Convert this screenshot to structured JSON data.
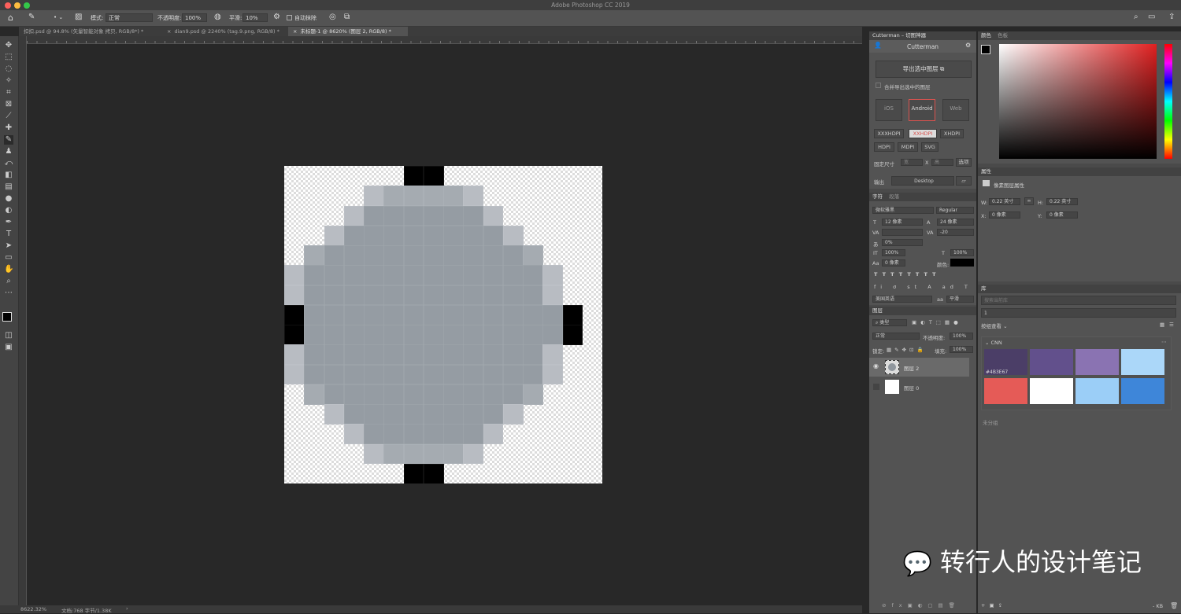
{
  "app": {
    "title": "Adobe Photoshop CC 2019"
  },
  "options_bar": {
    "mode_label": "模式:",
    "mode_value": "正常",
    "opacity_label": "不透明度:",
    "opacity_value": "100%",
    "smooth_label": "平滑:",
    "smooth_value": "10%",
    "auto_erase_label": "自动抹除"
  },
  "doc_tabs": [
    {
      "label": "扣扣.psd @ 94.8% (矢量智能对象 拷贝, RGB/8*) *"
    },
    {
      "label": "dian9.psd @ 2240% (tag.9.png, RGB/8) *"
    },
    {
      "label": "未标题-1 @ 8620% (图层 2, RGB/8) *"
    }
  ],
  "status": {
    "zoom": "8622.32%",
    "doc": "文档:768 字节/1.38K"
  },
  "cutterman": {
    "tab": "Cutterman – 切图神器",
    "title": "Cutterman",
    "export_button": "导出选中图层",
    "merge_label": "合并导出选中的图层",
    "platforms": [
      "iOS",
      "Android",
      "Web"
    ],
    "dpi_row1": [
      "XXXHDPI",
      "XXHDPI",
      "XHDPI"
    ],
    "dpi_row2": [
      "HDPI",
      "MDPI",
      "SVG"
    ],
    "size_label": "固定尺寸",
    "width_ph": "宽",
    "x_label": "X",
    "height_ph": "高",
    "select_button": "选项",
    "output_label": "输出",
    "output_value": "Desktop"
  },
  "color_panel": {
    "tabs": [
      "颜色",
      "色板"
    ]
  },
  "properties_panel": {
    "tab": "属性",
    "type_label": "像素图层属性",
    "w_label": "W:",
    "w_value": "0.22 英寸",
    "h_label": "H:",
    "h_value": "0.22 英寸",
    "x_label": "X:",
    "x_value": "0 像素",
    "y_label": "Y:",
    "y_value": "0 像素"
  },
  "character_panel": {
    "tabs": [
      "字符",
      "段落"
    ],
    "font": "微软雅黑",
    "style": "Regular",
    "size": "12 像素",
    "leading": "24 像素",
    "tracking": "-20",
    "scale_pct": "0%",
    "vscale": "100%",
    "hscale": "100%",
    "baseline": "0 像素",
    "color_label": "颜色:",
    "language": "美国英语",
    "aa_label": "aa",
    "aa_value": "平滑"
  },
  "layers_panel": {
    "tab": "图层",
    "filter": "类型",
    "blend": "正常",
    "opacity_label": "不透明度:",
    "opacity_value": "100%",
    "lock_label": "锁定:",
    "fill_label": "填充:",
    "fill_value": "100%",
    "layers": [
      {
        "name": "图层 2"
      },
      {
        "name": "图层 0"
      }
    ]
  },
  "library_panel": {
    "tab": "库",
    "search_ph": "搜索当前库",
    "library_value": "1",
    "view_label": "按组查看",
    "group": "CNN",
    "hex": "#4B3E67",
    "ungrouped": "未分组",
    "size_label": "KB",
    "swatch_colors": [
      "#4B3E67",
      "#62508C",
      "#8A73B2",
      "#ABD7F9",
      "#E55B57",
      "#FFFFFF",
      "#9BCEF7",
      "#3E86D9"
    ]
  },
  "watermark": "转行人的设计笔记",
  "pixel_art": {
    "pixel_columns": 16,
    "pixel_rows": 16,
    "colors": {
      "light": "#b8bcc2",
      "mid": "#a5abb1",
      "core": "#959ca3",
      "black": "#000000"
    },
    "rows": [
      "......KK........",
      "....LMMMML......",
      "...LCCCCCCL.....",
      "..LCCCCCCCCL....",
      ".MCCCCCCCCCCM...",
      "LCCCCCCCCCCCCL..",
      "LCCCCCCCCCCCCL..",
      "KCCCCCCCCCCCCCK.",
      "KCCCCCCCCCCCCCK.",
      "LCCCCCCCCCCCCL..",
      "LCCCCCCCCCCCCL..",
      ".MCCCCCCCCCCM...",
      "..LCCCCCCCCL....",
      "...LCCCCCCL.....",
      "....LMMMML......",
      "......KK........"
    ]
  }
}
